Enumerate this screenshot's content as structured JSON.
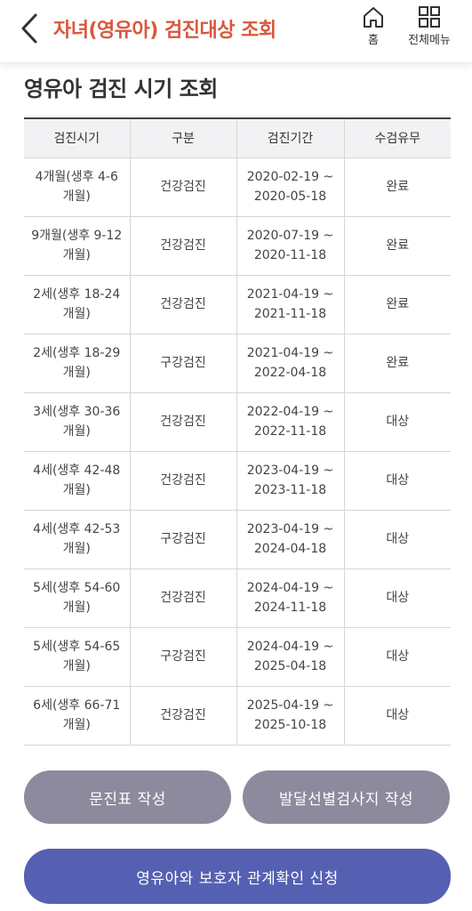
{
  "header": {
    "title": "자녀(영유아) 검진대상 조회",
    "home_label": "홈",
    "menu_label": "전체메뉴"
  },
  "section_title": "영유아 검진 시기 조회",
  "table": {
    "columns": [
      "검진시기",
      "구분",
      "검진기간",
      "수검유무"
    ],
    "rows": [
      {
        "period": "4개월(생후 4-6 개월)",
        "type": "건강검진",
        "range_start": "2020-02-19 ~",
        "range_end": "2020-05-18",
        "status": "완료"
      },
      {
        "period": "9개월(생후 9-12 개월)",
        "type": "건강검진",
        "range_start": "2020-07-19 ~",
        "range_end": "2020-11-18",
        "status": "완료"
      },
      {
        "period": "2세(생후 18-24 개월)",
        "type": "건강검진",
        "range_start": "2021-04-19 ~",
        "range_end": "2021-11-18",
        "status": "완료"
      },
      {
        "period": "2세(생후 18-29 개월)",
        "type": "구강검진",
        "range_start": "2021-04-19 ~",
        "range_end": "2022-04-18",
        "status": "완료"
      },
      {
        "period": "3세(생후 30-36 개월)",
        "type": "건강검진",
        "range_start": "2022-04-19 ~",
        "range_end": "2022-11-18",
        "status": "대상"
      },
      {
        "period": "4세(생후 42-48 개월)",
        "type": "건강검진",
        "range_start": "2023-04-19 ~",
        "range_end": "2023-11-18",
        "status": "대상"
      },
      {
        "period": "4세(생후 42-53 개월)",
        "type": "구강검진",
        "range_start": "2023-04-19 ~",
        "range_end": "2024-04-18",
        "status": "대상"
      },
      {
        "period": "5세(생후 54-60 개월)",
        "type": "건강검진",
        "range_start": "2024-04-19 ~",
        "range_end": "2024-11-18",
        "status": "대상"
      },
      {
        "period": "5세(생후 54-65 개월)",
        "type": "구강검진",
        "range_start": "2024-04-19 ~",
        "range_end": "2025-04-18",
        "status": "대상"
      },
      {
        "period": "6세(생후 66-71 개월)",
        "type": "건강검진",
        "range_start": "2025-04-19 ~",
        "range_end": "2025-10-18",
        "status": "대상"
      }
    ]
  },
  "buttons": {
    "questionnaire": "문진표 작성",
    "development": "발달선별검사지 작성",
    "relation": "영유아와 보호자 관계확인 신청"
  },
  "colors": {
    "title_accent": "#d9573b",
    "gray_button": "#8d8a9e",
    "primary_button": "#5560b2"
  }
}
